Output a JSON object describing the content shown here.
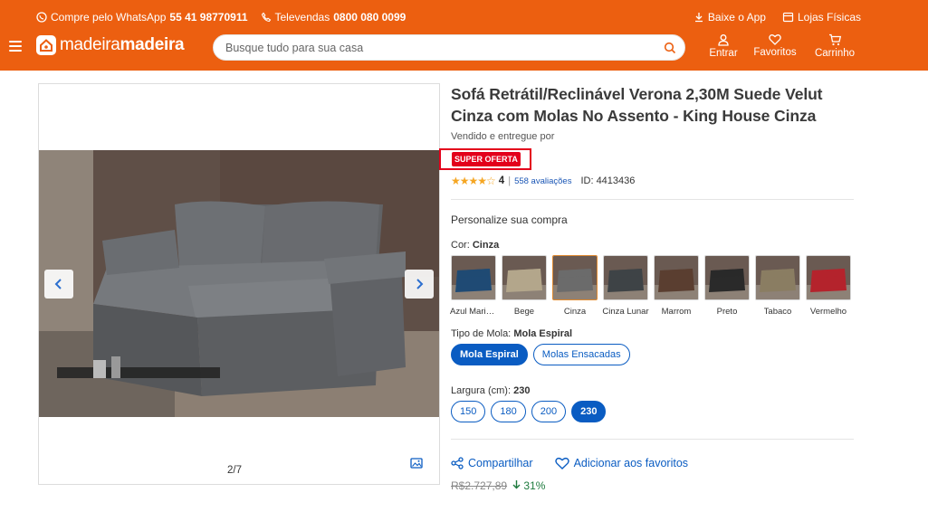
{
  "header": {
    "whatsapp_label": "Compre pelo WhatsApp",
    "whatsapp_number": "55 41 98770911",
    "televendas_label": "Televendas",
    "televendas_number": "0800 080 0099",
    "app_label": "Baixe o App",
    "stores_label": "Lojas Físicas",
    "logo_part1": "madeira",
    "logo_part2": "madeira",
    "search_placeholder": "Busque tudo para sua casa",
    "login_label": "Entrar",
    "favorites_label": "Favoritos",
    "cart_label": "Carrinho"
  },
  "gallery": {
    "counter": "2/7"
  },
  "product": {
    "title": "Sofá Retrátil/Reclinável Verona 2,30M Suede Velut Cinza com Molas No Assento - King House Cinza",
    "seller_label": "Vendido e entregue por",
    "offer_badge": "SUPER OFERTA",
    "stars": "★★★★☆",
    "rating_value": "4",
    "rating_sep": "|",
    "reviews": "558 avaliações",
    "id_label": "ID: 4413436",
    "personalize_label": "Personalize sua compra",
    "color_label": "Cor:",
    "color_value": "Cinza",
    "colors": [
      {
        "name": "Azul Marinho",
        "hex": "#1f4a74"
      },
      {
        "name": "Bege",
        "hex": "#b3a68b"
      },
      {
        "name": "Cinza",
        "hex": "#6b6b6b"
      },
      {
        "name": "Cinza Lunar",
        "hex": "#3e4346"
      },
      {
        "name": "Marrom",
        "hex": "#5a3e30"
      },
      {
        "name": "Preto",
        "hex": "#2a2a2a"
      },
      {
        "name": "Tabaco",
        "hex": "#8a7d62"
      },
      {
        "name": "Vermelho",
        "hex": "#b4232c"
      }
    ],
    "spring_label": "Tipo de Mola:",
    "spring_value": "Mola Espiral",
    "spring_options": [
      "Mola Espiral",
      "Molas Ensacadas"
    ],
    "width_label": "Largura (cm):",
    "width_value": "230",
    "width_options": [
      "150",
      "180",
      "200",
      "230"
    ],
    "share_label": "Compartilhar",
    "fav_label": "Adicionar aos favoritos",
    "old_price": "R$2.727,89",
    "discount": "31%"
  },
  "colors": {
    "brand_orange": "#ec5f10",
    "link_blue": "#0a5cc2",
    "offer_red": "#e3001b"
  }
}
